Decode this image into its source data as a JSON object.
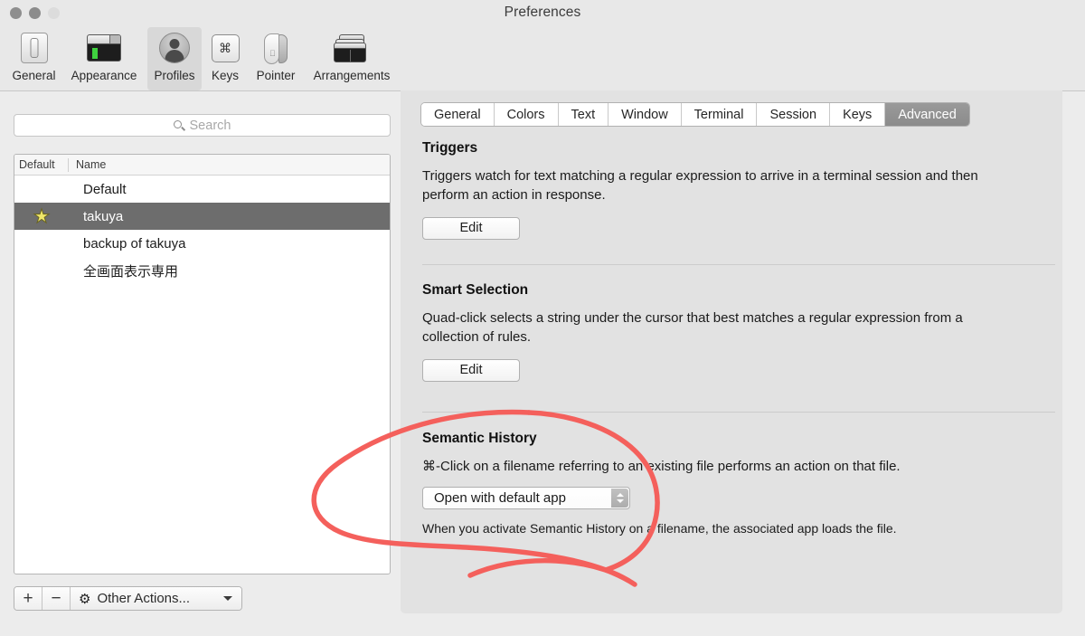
{
  "window": {
    "title": "Preferences",
    "traffic_lights": [
      "close-button",
      "minimize-button",
      "zoom-button"
    ]
  },
  "toolbar": {
    "items": [
      {
        "label": "General",
        "icon": "toggle-switch-icon",
        "selected": false
      },
      {
        "label": "Appearance",
        "icon": "window-appearance-icon",
        "selected": false
      },
      {
        "label": "Profiles",
        "icon": "person-silhouette-icon",
        "selected": true
      },
      {
        "label": "Keys",
        "icon": "command-key-icon",
        "selected": false
      },
      {
        "label": "Pointer",
        "icon": "mouse-icon",
        "selected": false
      },
      {
        "label": "Arrangements",
        "icon": "stacked-windows-icon",
        "selected": false
      }
    ]
  },
  "sidebar": {
    "search": {
      "placeholder": "Search",
      "value": "",
      "icon": "search-icon"
    },
    "columns": [
      "Default",
      "Name"
    ],
    "profiles": [
      {
        "name": "Default",
        "default": false,
        "selected": false
      },
      {
        "name": "takuya",
        "default": true,
        "selected": true
      },
      {
        "name": "backup of takuya",
        "default": false,
        "selected": false
      },
      {
        "name": "全画面表示専用",
        "default": false,
        "selected": false
      }
    ],
    "star_glyph": "★",
    "footer": {
      "add_label": "+",
      "remove_label": "−",
      "other_actions_label": "Other Actions...",
      "gear_glyph": "✷"
    }
  },
  "tabs": [
    {
      "label": "General",
      "active": false
    },
    {
      "label": "Colors",
      "active": false
    },
    {
      "label": "Text",
      "active": false
    },
    {
      "label": "Window",
      "active": false
    },
    {
      "label": "Terminal",
      "active": false
    },
    {
      "label": "Session",
      "active": false
    },
    {
      "label": "Keys",
      "active": false
    },
    {
      "label": "Advanced",
      "active": true
    }
  ],
  "sections": {
    "triggers": {
      "title": "Triggers",
      "description": "Triggers watch for text matching a regular expression to arrive in a terminal session and then perform an action in response.",
      "button": "Edit"
    },
    "smart_selection": {
      "title": "Smart Selection",
      "description": "Quad-click selects a string under the cursor that best matches a regular expression from a collection of rules.",
      "button": "Edit"
    },
    "semantic_history": {
      "title": "Semantic History",
      "description": "⌘-Click on a filename referring to an existing file performs an action on that file.",
      "popup_value": "Open with default app",
      "note": "When you activate Semantic History on a filename, the associated app loads the file."
    }
  },
  "annotation": {
    "shape": "hand-drawn-circle",
    "color": "#f4605c"
  },
  "colors": {
    "window_chrome": "#e8e8e8",
    "panel_background": "#e2e2e2",
    "page_background": "#ececec",
    "selection": "#6d6d6d",
    "active_tab": "#8f8f8f",
    "star": "#efe76a",
    "annotation_red": "#f4605c"
  }
}
